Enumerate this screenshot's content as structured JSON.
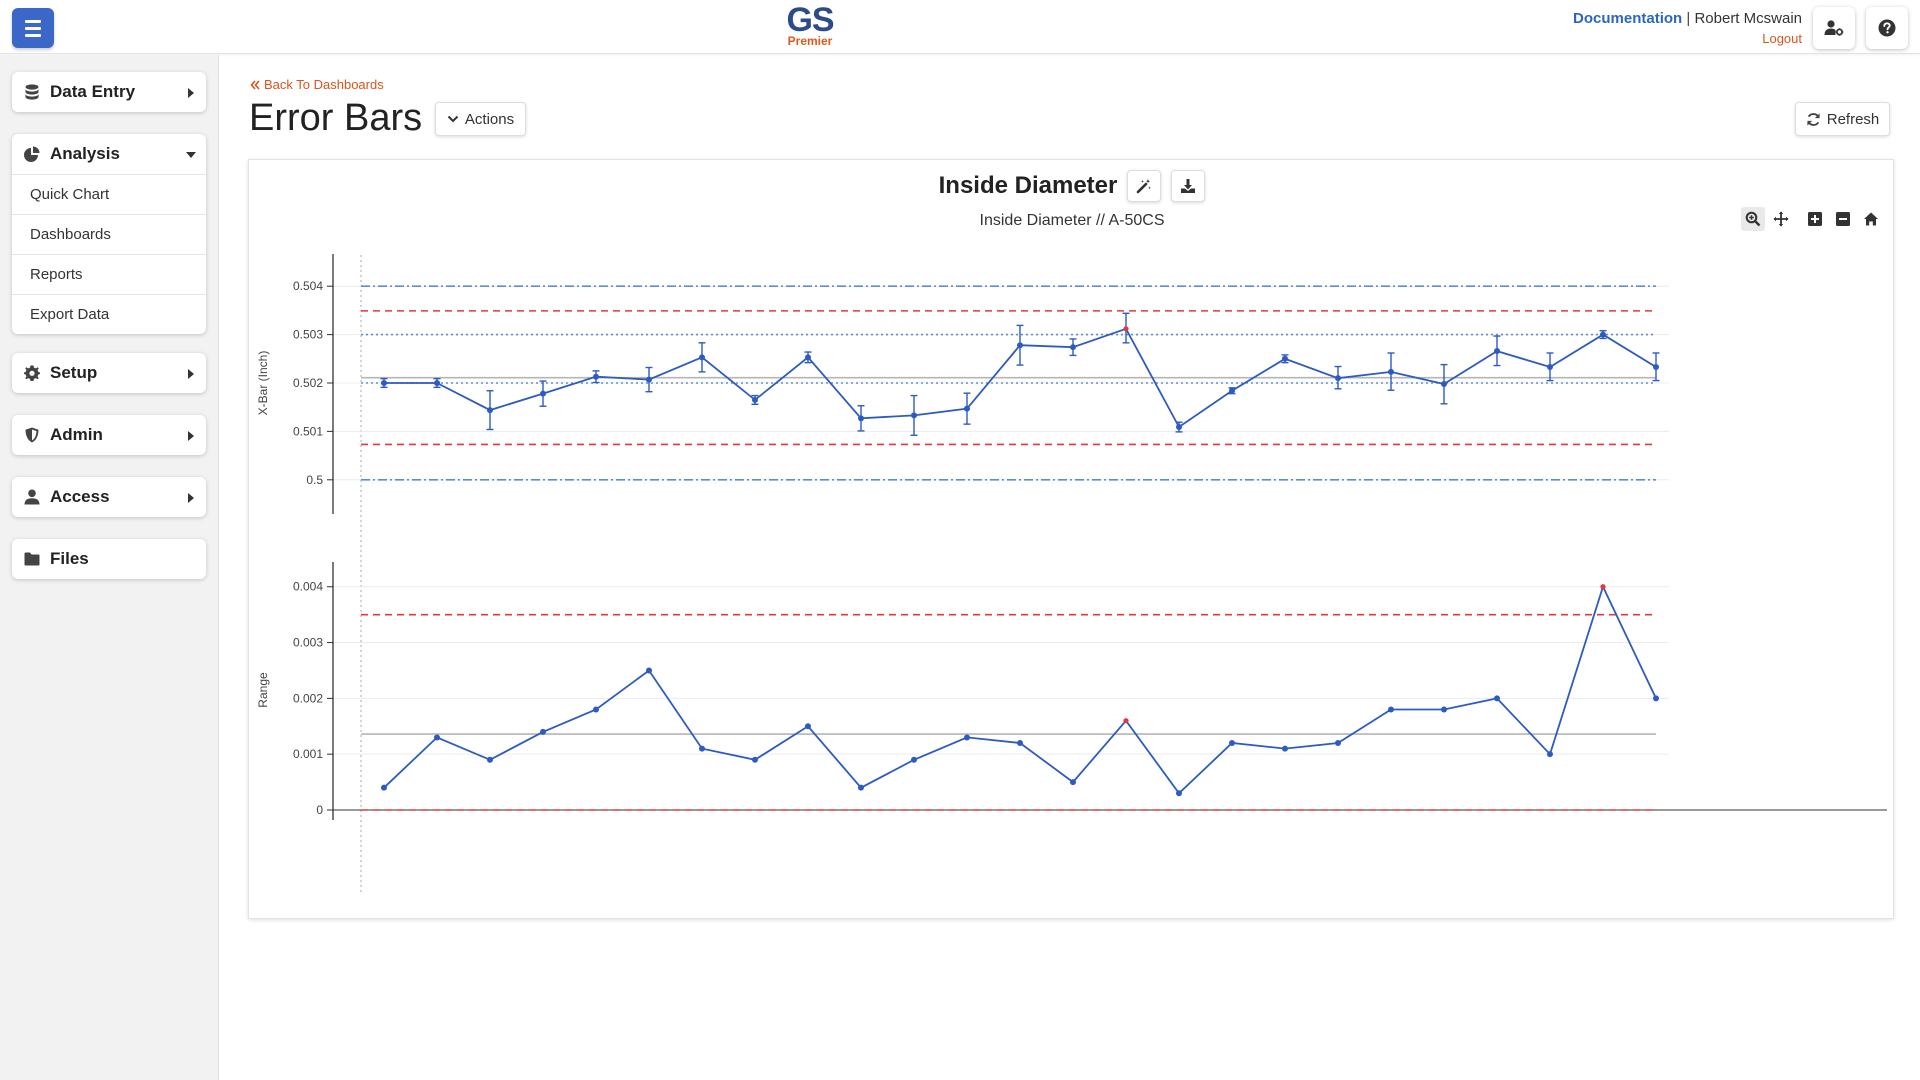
{
  "header": {
    "logo_main": "GS",
    "logo_sub": "Premier",
    "documentation_label": "Documentation",
    "separator": "|",
    "user_name": "Robert Mcswain",
    "logout_label": "Logout"
  },
  "sidebar": {
    "data_entry": "Data Entry",
    "analysis": "Analysis",
    "analysis_items": [
      "Quick Chart",
      "Dashboards",
      "Reports",
      "Export Data"
    ],
    "setup": "Setup",
    "admin": "Admin",
    "access": "Access",
    "files": "Files"
  },
  "page": {
    "back_label": "Back To Dashboards",
    "title": "Error Bars",
    "actions_label": "Actions",
    "refresh_label": "Refresh"
  },
  "chart_card": {
    "title": "Inside Diameter",
    "subtitle": "Inside Diameter  //  A-50CS"
  },
  "colors": {
    "accent": "#3a67c8",
    "series": "#2e5bc0",
    "control_limit": "#e0393e",
    "spec_limit": "#5b8ed6",
    "center_line": "#b5b5b5",
    "violation": "#e0393e",
    "link": "#2c66c3",
    "logout": "#d9551d"
  },
  "chart_data": [
    {
      "type": "line",
      "title": "",
      "xlabel": "",
      "ylabel": "X-Bar (Inch)",
      "ylim": [
        0.4995,
        0.5045
      ],
      "yticks": [
        0.5,
        0.501,
        0.502,
        0.503,
        0.504
      ],
      "ytick_labels": [
        "0.5",
        "0.501",
        "0.502",
        "0.503",
        "0.504"
      ],
      "values": [
        0.502,
        0.502,
        0.50144,
        0.50178,
        0.50213,
        0.50207,
        0.50253,
        0.50165,
        0.50253,
        0.50127,
        0.50133,
        0.50147,
        0.50278,
        0.50274,
        0.50312,
        0.50109,
        0.50184,
        0.5025,
        0.5021,
        0.50223,
        0.50198,
        0.50266,
        0.50233,
        0.503,
        0.50233
      ],
      "error_low": [
        0.50191,
        0.50191,
        0.50104,
        0.50152,
        0.50201,
        0.50182,
        0.50223,
        0.50156,
        0.50242,
        0.50101,
        0.50092,
        0.50115,
        0.50237,
        0.50257,
        0.50283,
        0.50099,
        0.50178,
        0.50242,
        0.50188,
        0.50185,
        0.50157,
        0.50236,
        0.50205,
        0.50292,
        0.50205
      ],
      "error_high": [
        0.50209,
        0.50209,
        0.50184,
        0.50204,
        0.50225,
        0.50232,
        0.50283,
        0.50174,
        0.50264,
        0.50153,
        0.50174,
        0.50179,
        0.50319,
        0.50291,
        0.50344,
        0.50119,
        0.5019,
        0.50258,
        0.50234,
        0.50262,
        0.50238,
        0.50297,
        0.50262,
        0.50308,
        0.50262
      ],
      "violations": [
        14
      ],
      "center_line": 0.50211,
      "control_limits": [
        0.50073,
        0.50349
      ],
      "spec_limits": [
        0.5,
        0.504
      ],
      "inner_dotted_lines": [
        0.502,
        0.503
      ]
    },
    {
      "type": "line",
      "title": "",
      "xlabel": "",
      "ylabel": "Range",
      "ylim": [
        0,
        0.0043
      ],
      "yticks": [
        0,
        0.001,
        0.002,
        0.003,
        0.004
      ],
      "ytick_labels": [
        "0",
        "0.001",
        "0.002",
        "0.003",
        "0.004"
      ],
      "values": [
        0.0004,
        0.0013,
        0.0009,
        0.0014,
        0.0018,
        0.0025,
        0.0011,
        0.0009,
        0.0015,
        0.0004,
        0.0009,
        0.0013,
        0.0012,
        0.0005,
        0.0016,
        0.0003,
        0.0012,
        0.0011,
        0.0012,
        0.0018,
        0.0018,
        0.002,
        0.001,
        0.004,
        0.002
      ],
      "violations": [
        14,
        23
      ],
      "center_line": 0.00136,
      "control_limits": [
        0,
        0.0035
      ]
    }
  ]
}
